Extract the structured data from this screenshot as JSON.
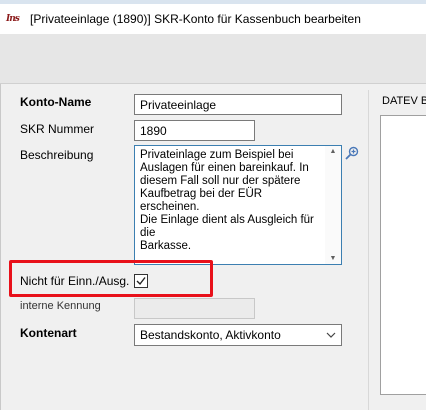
{
  "window": {
    "title": "[Privateeinlage (1890)] SKR-Konto für Kassenbuch bearbeiten",
    "logo_text": "Ins"
  },
  "form": {
    "konto_name_label": "Konto-Name",
    "konto_name_value": "Privateeinlage",
    "skr_label": "SKR Nummer",
    "skr_value": "1890",
    "beschreibung_label": "Beschreibung",
    "beschreibung_value": "Privateinlage zum Beispiel bei\nAuslagen für einen bareinkauf. In\ndiesem Fall soll nur der spätere\nKaufbetrag bei der EÜR erscheinen.\nDie Einlage dient als Ausgleich für die\nBarkasse.",
    "nicht_label": "Nicht für Einn./Ausg.",
    "nicht_checked": true,
    "kennung_label": "interne Kennung",
    "kennung_value": "",
    "kontenart_label": "Kontenart",
    "kontenart_value": "Bestandskonto, Aktivkonto"
  },
  "datev": {
    "title": "DATEV B"
  },
  "colors": {
    "highlight": "#e8101a",
    "focus_border": "#3c7fb1",
    "zoom_icon": "#4a78b8"
  },
  "icons": {
    "zoom": "magnifier-plus-icon",
    "dropdown": "chevron-down-icon",
    "check": "checkmark-icon"
  }
}
